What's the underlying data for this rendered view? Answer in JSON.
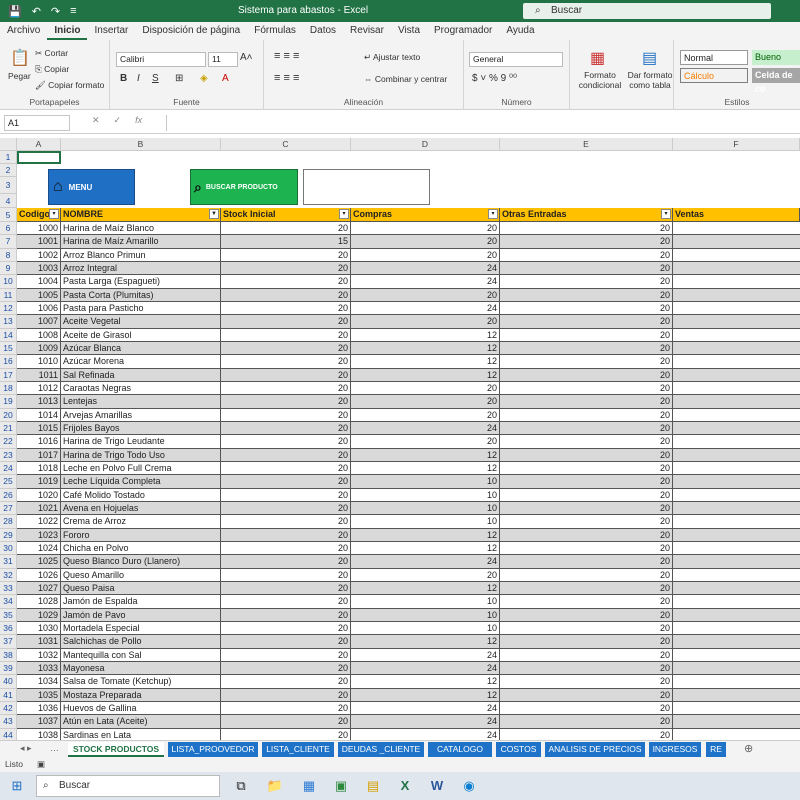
{
  "titlebar": {
    "title": "Sistema para abastos  -  Excel",
    "search_placeholder": "Buscar"
  },
  "menu": [
    "Archivo",
    "Inicio",
    "Insertar",
    "Disposición de página",
    "Fórmulas",
    "Datos",
    "Revisar",
    "Vista",
    "Programador",
    "Ayuda"
  ],
  "ribbon": {
    "paste": "Pegar",
    "cut": "Cortar",
    "copy": "Copiar",
    "copy_format": "Copiar formato",
    "clipboard": "Portapapeles",
    "font_name": "Calibri",
    "font_size": "11",
    "font_group": "Fuente",
    "wrap_text": "Ajustar texto",
    "merge_center": "Combinar y centrar",
    "alignment_group": "Alineación",
    "number_format": "General",
    "number_group": "Número",
    "cond_format": "Formato condicional",
    "table_format": "Dar formato como tabla",
    "styles_group": "Estilos",
    "style_normal": "Normal",
    "style_bueno": "Bueno",
    "style_calculo": "Cálculo",
    "style_celda": "Celda de co"
  },
  "formula": {
    "namebox": "A1",
    "value": ""
  },
  "columns": [
    "A",
    "B",
    "C",
    "D",
    "E",
    "F"
  ],
  "buttons": {
    "menu": "MENU",
    "buscar": "BUSCAR PRODUCTO"
  },
  "table_headers": [
    "Codigo",
    "NOMBRE",
    "Stock Inicial",
    "Compras",
    "Otras Entradas",
    "Ventas"
  ],
  "rows": [
    [
      "1000",
      "Harina de Maíz Blanco",
      "20",
      "20",
      "20"
    ],
    [
      "1001",
      "Harina de Maíz Amarillo",
      "15",
      "20",
      "20"
    ],
    [
      "1002",
      "Arroz Blanco Primun",
      "20",
      "20",
      "20"
    ],
    [
      "1003",
      "Arroz Integral",
      "20",
      "24",
      "20"
    ],
    [
      "1004",
      "Pasta Larga (Espagueti)",
      "20",
      "24",
      "20"
    ],
    [
      "1005",
      "Pasta Corta (Plumitas)",
      "20",
      "20",
      "20"
    ],
    [
      "1006",
      "Pasta para Pasticho",
      "20",
      "24",
      "20"
    ],
    [
      "1007",
      "Aceite Vegetal",
      "20",
      "20",
      "20"
    ],
    [
      "1008",
      "Aceite de Girasol",
      "20",
      "12",
      "20"
    ],
    [
      "1009",
      "Azúcar Blanca",
      "20",
      "12",
      "20"
    ],
    [
      "1010",
      "Azúcar Morena",
      "20",
      "12",
      "20"
    ],
    [
      "1011",
      "Sal Refinada",
      "20",
      "12",
      "20"
    ],
    [
      "1012",
      "Caraotas Negras",
      "20",
      "20",
      "20"
    ],
    [
      "1013",
      "Lentejas",
      "20",
      "20",
      "20"
    ],
    [
      "1014",
      "Arvejas Amarillas",
      "20",
      "20",
      "20"
    ],
    [
      "1015",
      "Frijoles Bayos",
      "20",
      "24",
      "20"
    ],
    [
      "1016",
      "Harina de Trigo Leudante",
      "20",
      "20",
      "20"
    ],
    [
      "1017",
      "Harina de Trigo Todo Uso",
      "20",
      "12",
      "20"
    ],
    [
      "1018",
      "Leche en Polvo Full Crema",
      "20",
      "12",
      "20"
    ],
    [
      "1019",
      "Leche Líquida Completa",
      "20",
      "10",
      "20"
    ],
    [
      "1020",
      "Café Molido Tostado",
      "20",
      "10",
      "20"
    ],
    [
      "1021",
      "Avena en Hojuelas",
      "20",
      "10",
      "20"
    ],
    [
      "1022",
      "Crema de Arroz",
      "20",
      "10",
      "20"
    ],
    [
      "1023",
      "Fororo",
      "20",
      "12",
      "20"
    ],
    [
      "1024",
      "Chicha en Polvo",
      "20",
      "12",
      "20"
    ],
    [
      "1025",
      "Queso Blanco Duro (Llanero)",
      "20",
      "24",
      "20"
    ],
    [
      "1026",
      "Queso Amarillo",
      "20",
      "20",
      "20"
    ],
    [
      "1027",
      "Queso Paisa",
      "20",
      "12",
      "20"
    ],
    [
      "1028",
      "Jamón de Espalda",
      "20",
      "10",
      "20"
    ],
    [
      "1029",
      "Jamón de Pavo",
      "20",
      "10",
      "20"
    ],
    [
      "1030",
      "Mortadela Especial",
      "20",
      "10",
      "20"
    ],
    [
      "1031",
      "Salchichas de Pollo",
      "20",
      "12",
      "20"
    ],
    [
      "1032",
      "Mantequilla con Sal",
      "20",
      "24",
      "20"
    ],
    [
      "1033",
      "Mayonesa",
      "20",
      "24",
      "20"
    ],
    [
      "1034",
      "Salsa de Tomate (Ketchup)",
      "20",
      "12",
      "20"
    ],
    [
      "1035",
      "Mostaza Preparada",
      "20",
      "12",
      "20"
    ],
    [
      "1036",
      "Huevos de Gallina",
      "20",
      "24",
      "20"
    ],
    [
      "1037",
      "Atún en Lata (Aceite)",
      "20",
      "24",
      "20"
    ],
    [
      "1038",
      "Sardinas en Lata",
      "20",
      "24",
      "20"
    ]
  ],
  "sheets": [
    "STOCK PRODUCTOS",
    "LISTA_PROOVEDOR",
    "LISTA_CLIENTE",
    "DEUDAS _CLIENTE",
    "CATALOGO",
    "COSTOS",
    "ANALISIS DE PRECIOS",
    "INGRESOS",
    "RE"
  ],
  "status": "Listo",
  "taskbar": {
    "search": "Buscar"
  }
}
